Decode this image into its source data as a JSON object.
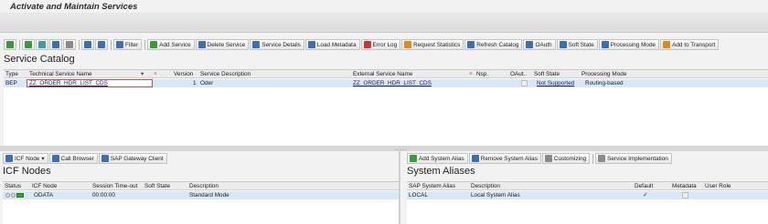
{
  "window": {
    "title": "Activate and Maintain Services"
  },
  "toolbar": {
    "icon_buttons": [
      "zoom-icon",
      "filter-list-icon",
      "sort-ascending-icon",
      "find-icon",
      "print-icon",
      "export-icon",
      "layout-icon"
    ],
    "buttons": [
      {
        "label": "Filter",
        "icon": "filter-icon"
      },
      {
        "label": "Add Service",
        "icon": "add-service-icon"
      },
      {
        "label": "Delete Service",
        "icon": "trash-icon"
      },
      {
        "label": "Service Details",
        "icon": "details-icon"
      },
      {
        "label": "Load Metadata",
        "icon": "load-metadata-icon"
      },
      {
        "label": "Error Log",
        "icon": "error-log-icon"
      },
      {
        "label": "Request Statistics",
        "icon": "statistics-icon"
      },
      {
        "label": "Refresh Catalog",
        "icon": "refresh-icon"
      },
      {
        "label": "OAuth",
        "icon": "oauth-icon"
      },
      {
        "label": "Soft State",
        "icon": "soft-state-icon"
      },
      {
        "label": "Processing Mode",
        "icon": "pencil-icon"
      },
      {
        "label": "Add to Transport",
        "icon": "transport-icon"
      }
    ]
  },
  "catalog": {
    "title": "Service Catalog",
    "columns": {
      "type": "Type",
      "tech_name": "Technical Service Name",
      "version": "Version",
      "service_desc": "Service Description",
      "external_name": "External Service Name",
      "namespace": "Nsp.",
      "oauth": "OAut..",
      "soft_state": "Soft State",
      "processing_mode": "Processing Mode"
    },
    "rows": [
      {
        "type": "BEP",
        "tech_name": "ZZ_ORDER_HDR_LIST_CDS",
        "version": "1",
        "service_desc": "Oder",
        "external_name": "ZZ_ORDER_HDR_LIST_CDS",
        "namespace": "",
        "soft_state": "Not Supported",
        "processing_mode": "Routing-based"
      }
    ]
  },
  "splitter": {
    "grip": "....."
  },
  "icf": {
    "toolbar": {
      "icf_node": "ICF Node",
      "call_browser": "Call Browser",
      "gateway_client": "SAP Gateway Client"
    },
    "title": "ICF Nodes",
    "columns": {
      "status": "Status",
      "node": "ICF Node",
      "timeout": "Session Time-out",
      "soft_state": "Soft State",
      "description": "Description"
    },
    "rows": [
      {
        "node": "ODATA",
        "timeout": "00:00:00",
        "soft_state": "",
        "description": "Standard Mode"
      }
    ]
  },
  "aliases": {
    "toolbar": {
      "add": "Add System Alias",
      "remove": "Remove System Alias",
      "customizing": "Customizing",
      "service_impl": "Service Implementation"
    },
    "title": "System Aliases",
    "columns": {
      "alias": "SAP System Alias",
      "description": "Description",
      "default": "Default",
      "metadata": "Metadata",
      "user_role": "User Role"
    },
    "rows": [
      {
        "alias": "LOCAL",
        "description": "Local System Alias",
        "default_mark": "✓"
      }
    ]
  }
}
